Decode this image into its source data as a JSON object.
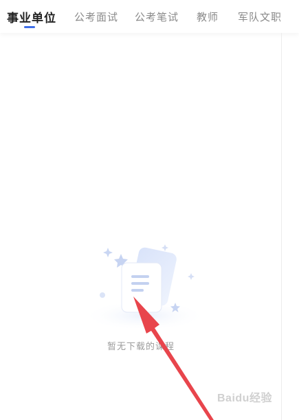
{
  "tabs": [
    {
      "label": "事业单位",
      "active": true
    },
    {
      "label": "公考面试",
      "active": false
    },
    {
      "label": "公考笔试",
      "active": false
    },
    {
      "label": "教师",
      "active": false
    },
    {
      "label": "军队文职",
      "active": false
    }
  ],
  "empty_state": {
    "icon": "document-icon",
    "message": "暂无下载的课程"
  },
  "colors": {
    "accent": "#3e6ee8",
    "arrow": "#e8454c"
  },
  "watermark": {
    "text": "Baidu经验"
  }
}
